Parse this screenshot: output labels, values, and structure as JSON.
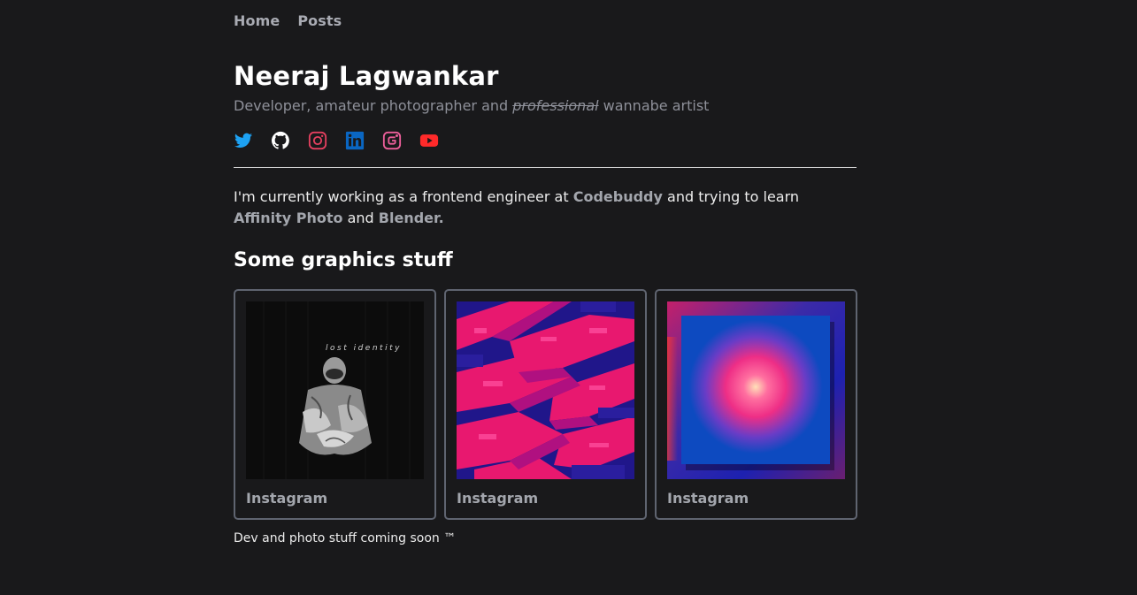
{
  "nav": {
    "items": [
      {
        "label": "Home"
      },
      {
        "label": "Posts"
      }
    ]
  },
  "profile": {
    "name": "Neeraj Lagwankar",
    "tagline_before": "Developer, amateur photographer and ",
    "tagline_struck": "professional",
    "tagline_after": " wannabe artist"
  },
  "socials": [
    {
      "icon": "twitter-icon",
      "color": "#1da1f2"
    },
    {
      "icon": "github-icon",
      "color": "#ffffff"
    },
    {
      "icon": "instagram-icon",
      "color": "#e4405f"
    },
    {
      "icon": "linkedin-icon",
      "color": "#0a66c2"
    },
    {
      "icon": "glitch-icon",
      "color": "#ec5f9a"
    },
    {
      "icon": "youtube-icon",
      "color": "#ff2a2a"
    }
  ],
  "intro": {
    "text_1": "I'm currently working as a frontend engineer at ",
    "link_company": "Codebuddy",
    "text_2": " and trying to learn ",
    "link_affinity": "Affinity Photo",
    "text_3": " and ",
    "link_blender": "Blender.",
    "text_4": ""
  },
  "graphics": {
    "title": "Some graphics stuff",
    "cards": [
      {
        "label": "Instagram",
        "image_caption": "lost identity"
      },
      {
        "label": "Instagram"
      },
      {
        "label": "Instagram"
      }
    ]
  },
  "footer_note": "Dev and photo stuff coming soon ™"
}
